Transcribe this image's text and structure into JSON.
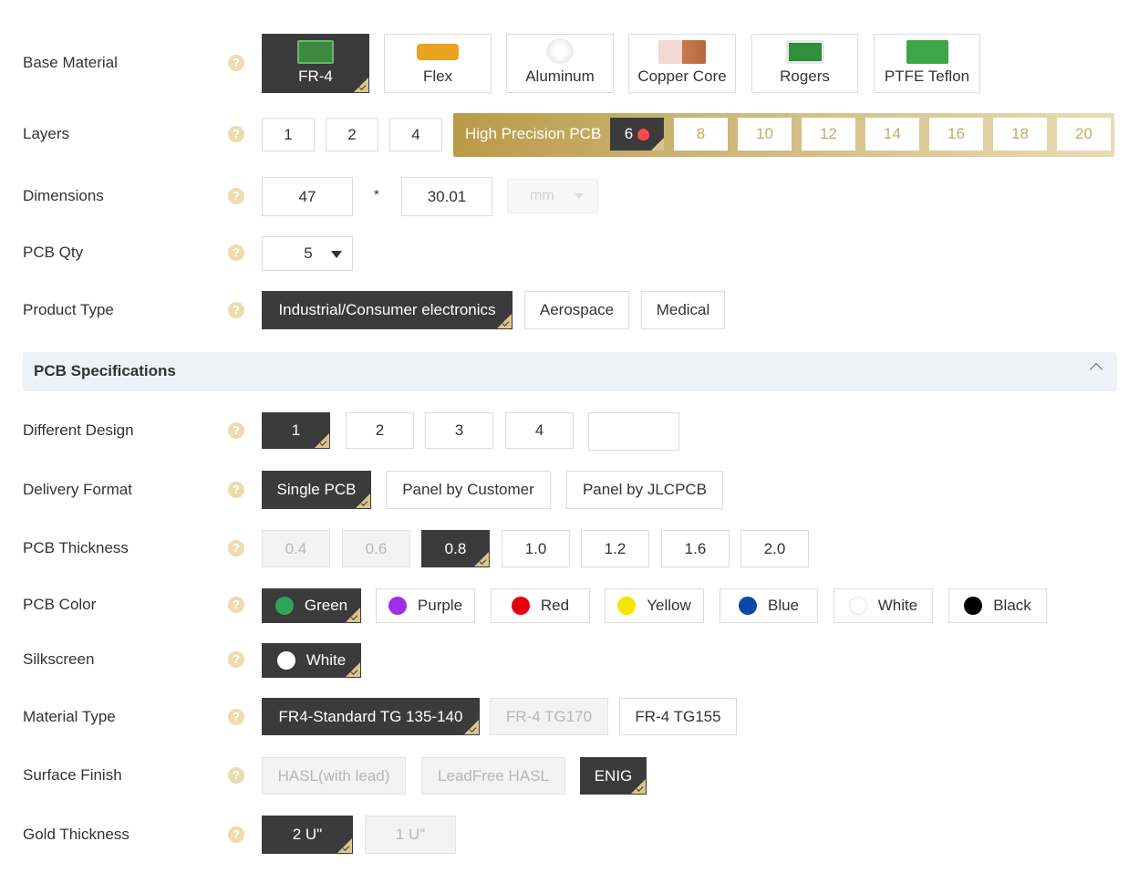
{
  "base_material": {
    "label": "Base Material",
    "options": [
      "FR-4",
      "Flex",
      "Aluminum",
      "Copper Core",
      "Rogers",
      "PTFE Teflon"
    ],
    "selected": "FR-4"
  },
  "layers": {
    "label": "Layers",
    "standard": [
      "1",
      "2",
      "4"
    ],
    "high_precision_label": "High Precision PCB",
    "high_precision": [
      "6",
      "8",
      "10",
      "12",
      "14",
      "16",
      "18",
      "20"
    ],
    "selected": "6"
  },
  "dimensions": {
    "label": "Dimensions",
    "width": "47",
    "separator": "*",
    "height": "30.01",
    "unit": "mm"
  },
  "pcb_qty": {
    "label": "PCB Qty",
    "value": "5"
  },
  "product_type": {
    "label": "Product Type",
    "options": [
      "Industrial/Consumer electronics",
      "Aerospace",
      "Medical"
    ],
    "selected": "Industrial/Consumer electronics"
  },
  "specs_section": {
    "title": "PCB Specifications"
  },
  "different_design": {
    "label": "Different Design",
    "options": [
      "1",
      "2",
      "3",
      "4"
    ],
    "custom_value": "",
    "selected": "1"
  },
  "delivery_format": {
    "label": "Delivery Format",
    "options": [
      "Single PCB",
      "Panel by Customer",
      "Panel by JLCPCB"
    ],
    "selected": "Single PCB"
  },
  "pcb_thickness": {
    "label": "PCB Thickness",
    "options": [
      "0.4",
      "0.6",
      "0.8",
      "1.0",
      "1.2",
      "1.6",
      "2.0"
    ],
    "selected": "0.8"
  },
  "pcb_color": {
    "label": "PCB Color",
    "options": [
      {
        "name": "Green",
        "color": "#2fa35a"
      },
      {
        "name": "Purple",
        "color": "#9b30e6"
      },
      {
        "name": "Red",
        "color": "#e60012"
      },
      {
        "name": "Yellow",
        "color": "#f5e600"
      },
      {
        "name": "Blue",
        "color": "#0b47a8"
      },
      {
        "name": "White",
        "color": "#ffffff"
      },
      {
        "name": "Black",
        "color": "#000000"
      }
    ],
    "selected": "Green"
  },
  "silkscreen": {
    "label": "Silkscreen",
    "value": "White",
    "color": "#ffffff"
  },
  "material_type": {
    "label": "Material Type",
    "options": [
      "FR4-Standard TG 135-140",
      "FR-4 TG170",
      "FR-4 TG155"
    ],
    "selected": "FR4-Standard TG 135-140"
  },
  "surface_finish": {
    "label": "Surface Finish",
    "options": [
      "HASL(with lead)",
      "LeadFree HASL",
      "ENIG"
    ],
    "selected": "ENIG"
  },
  "gold_thickness": {
    "label": "Gold Thickness",
    "options": [
      "2 U\"",
      "1 U\""
    ],
    "selected": "2 U\""
  },
  "help_glyph": "?"
}
